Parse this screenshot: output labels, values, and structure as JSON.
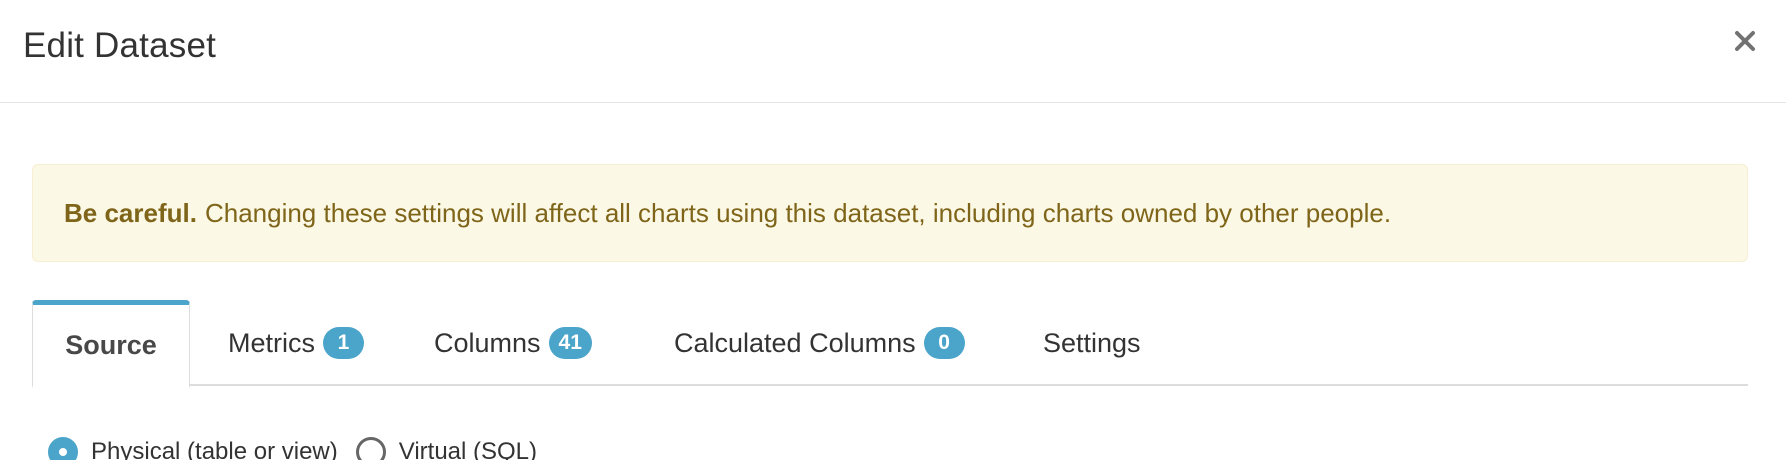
{
  "header": {
    "title": "Edit Dataset",
    "close_icon": "close-icon"
  },
  "alert": {
    "strong": "Be careful.",
    "message": "Changing these settings will affect all charts using this dataset, including charts owned by other people.",
    "text_color": "#7e6519",
    "background": "#fcf8e6"
  },
  "tabs": [
    {
      "label": "Source",
      "active": true
    },
    {
      "label": "Metrics",
      "badge": "1"
    },
    {
      "label": "Columns",
      "badge": "41"
    },
    {
      "label": "Calculated Columns",
      "badge": "0"
    },
    {
      "label": "Settings"
    }
  ],
  "source_type": {
    "options": [
      {
        "label": "Physical (table or view)",
        "checked": true
      },
      {
        "label": "Virtual (SQL)",
        "checked": false
      }
    ]
  },
  "colors": {
    "accent": "#4ba4c9"
  }
}
